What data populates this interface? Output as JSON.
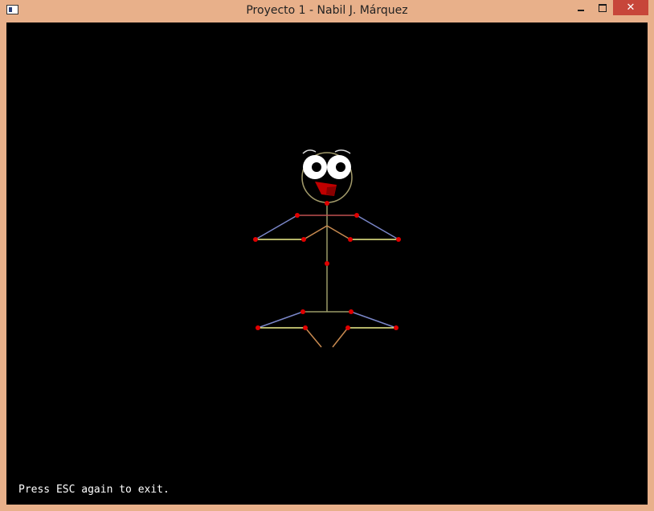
{
  "window": {
    "title": "Proyecto 1 - Nabil J. Márquez",
    "close_glyph": "✕"
  },
  "canvas": {
    "status_message": "Press ESC again to exit."
  },
  "colors": {
    "background": "#000000",
    "joint": "#e00000",
    "spine": "#9a9a68",
    "upper_limb": "#7a86c8",
    "lower_limb": "#f0f08a",
    "inner_limb": "#c88a50",
    "mouth": "#c00000"
  }
}
